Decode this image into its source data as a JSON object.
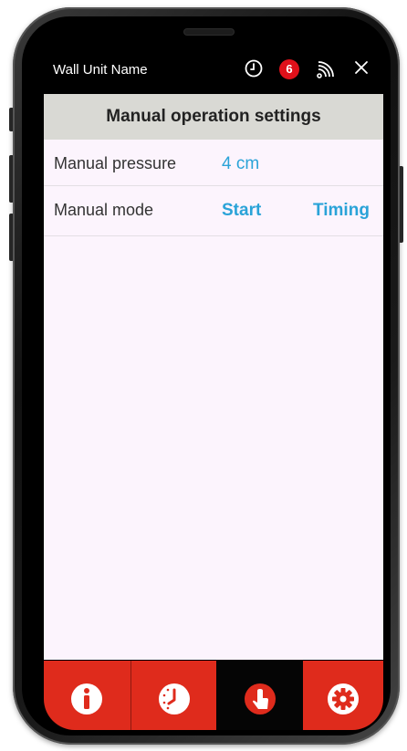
{
  "header": {
    "title": "Wall Unit Name",
    "badge_count": "6",
    "icons": [
      "clock-icon",
      "notification-badge",
      "signal-icon",
      "close-icon"
    ]
  },
  "section": {
    "title": "Manual operation settings"
  },
  "rows": [
    {
      "label": "Manual pressure",
      "value": "4 cm"
    },
    {
      "label": "Manual mode",
      "actions": [
        "Start",
        "Timing"
      ]
    }
  ],
  "tabs": [
    {
      "icon": "info-icon",
      "active": false
    },
    {
      "icon": "schedule-clock-icon",
      "active": false
    },
    {
      "icon": "manual-touch-icon",
      "active": true
    },
    {
      "icon": "settings-gear-icon",
      "active": false
    }
  ],
  "colors": {
    "accent_red": "#df2b1c",
    "link_blue": "#2aa3d8",
    "header_gray": "#d9d9d4",
    "screen_bg": "#fcf4fd",
    "active_tab": "#050505"
  }
}
